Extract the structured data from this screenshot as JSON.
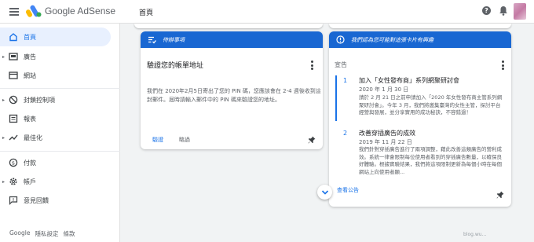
{
  "header": {
    "app_name": "Google AdSense",
    "page_title": "首頁",
    "help_label": "?"
  },
  "sidebar": {
    "items": [
      {
        "label": "首頁"
      },
      {
        "label": "廣告"
      },
      {
        "label": "網站"
      },
      {
        "label": "封鎖控制項"
      },
      {
        "label": "報表"
      },
      {
        "label": "最佳化"
      },
      {
        "label": "付款"
      },
      {
        "label": "帳戶"
      },
      {
        "label": "意見回饋"
      }
    ],
    "footer": [
      "Google",
      "隱私設定",
      "條款"
    ]
  },
  "todo_card": {
    "header": "待辦事項",
    "title": "驗證您的帳單地址",
    "body": "我們在 2020年2月5日寄出了您的 PIN 碼，您應該會在 2-4 週後收到這封郵件。屆時請輸入郵件中的 PIN 碼來驗證您的地址。",
    "action_primary": "驗證",
    "action_secondary": "略過"
  },
  "notice_card": {
    "header": "我們認為您可能對這張卡片有興趣",
    "label": "宣告",
    "items": [
      {
        "num": "1",
        "title": "加入「女性發布商」系列網聚研討會",
        "date": "2020 年 1 月 30 日",
        "text": "請於 2 月 21 日之前申請加入「2020 年女性發布商主管系列網聚研討會」。今年 3 月，我們將邀集臺灣的女性主管，探討平台經營與發展，並分享實用的成功秘訣，不容錯過！"
      },
      {
        "num": "2",
        "title": "改善穿插廣告的成效",
        "date": "2019 年 11 月 22 日",
        "text": "我們針對穿插廣告進行了兩項調整，藉此改善這類廣告的營利成效。系統一律會限制每位使用者看到的穿插廣告數量，以確保良好體驗。根據實驗結果，我們將這項限制更新為每個小時在每個網站上向使用者顯..."
      }
    ],
    "link": "查看公告"
  },
  "watermark": "blog.wu..."
}
